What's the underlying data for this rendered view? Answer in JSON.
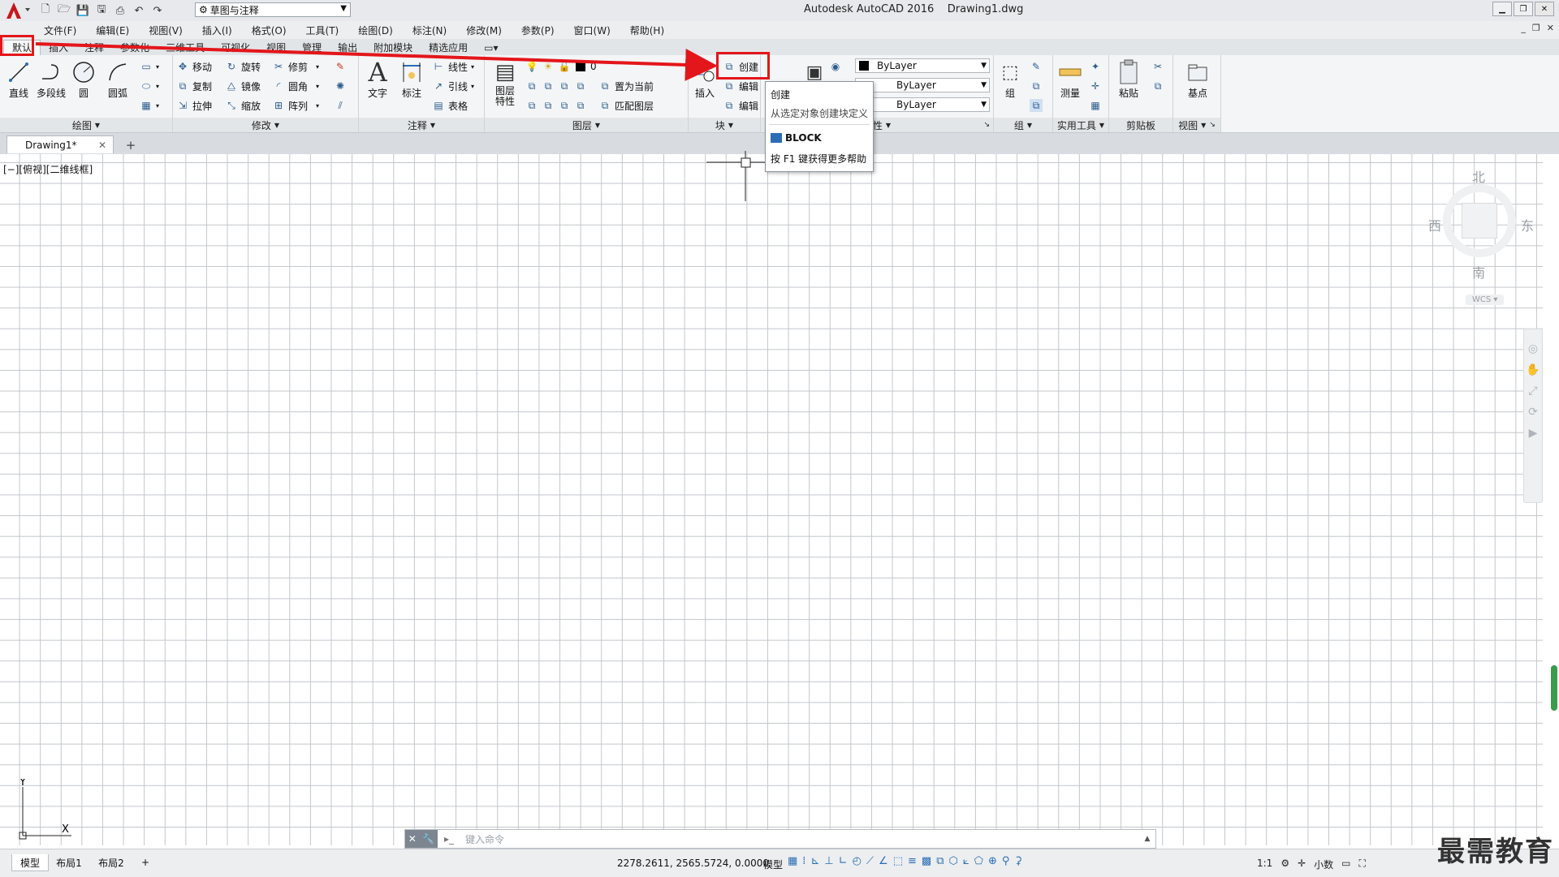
{
  "title": {
    "app": "Autodesk AutoCAD 2016",
    "file": "Drawing1.dwg",
    "workspace": "草图与注释"
  },
  "menu": [
    "文件(F)",
    "编辑(E)",
    "视图(V)",
    "插入(I)",
    "格式(O)",
    "工具(T)",
    "绘图(D)",
    "标注(N)",
    "修改(M)",
    "参数(P)",
    "窗口(W)",
    "帮助(H)"
  ],
  "ribbon_tabs": [
    "默认",
    "插入",
    "注释",
    "参数化",
    "三维工具",
    "可视化",
    "视图",
    "管理",
    "输出",
    "附加模块",
    "精选应用"
  ],
  "panels": {
    "draw": {
      "title": "绘图",
      "line": "直线",
      "polyline": "多段线",
      "circle": "圆",
      "arc": "圆弧"
    },
    "modify": {
      "title": "修改",
      "move": "移动",
      "rotate": "旋转",
      "trim": "修剪",
      "copy": "复制",
      "mirror": "镜像",
      "fillet": "圆角",
      "stretch": "拉伸",
      "scale": "缩放",
      "array": "阵列"
    },
    "annotation": {
      "title": "注释",
      "text": "文字",
      "dimension": "标注",
      "linear": "线性",
      "leader": "引线",
      "table": "表格"
    },
    "layers": {
      "title": "图层",
      "props": "图层\n特性",
      "props_l1": "图层",
      "props_l2": "特性",
      "layer_name": "0",
      "set_current": "置为当前",
      "match": "匹配图层"
    },
    "block": {
      "title": "块",
      "insert": "插入",
      "create": "创建",
      "edit": "编辑",
      "edit_attr": "编辑"
    },
    "properties": {
      "title": "特性",
      "color": "ByLayer",
      "linetype": "ByLayer",
      "lineweight": "ByLayer"
    },
    "groups": {
      "title": "组",
      "group": "组"
    },
    "utilities": {
      "title": "实用工具",
      "measure": "测量"
    },
    "clipboard": {
      "title": "剪贴板",
      "paste": "粘贴"
    },
    "view": {
      "title": "视图",
      "base": "基点"
    }
  },
  "tooltip": {
    "title": "创建",
    "desc": "从选定对象创建块定义",
    "command": "BLOCK",
    "help": "按 F1 键获得更多帮助"
  },
  "doc_tab": "Drawing1*",
  "viewport_label": "[−][俯视][二维线框]",
  "viewcube": {
    "north": "北",
    "south": "南",
    "west": "西",
    "east": "东",
    "wcs": "WCS"
  },
  "ucs": {
    "x": "X",
    "y": "Y"
  },
  "command_placeholder": "键入命令",
  "layout_tabs": [
    "模型",
    "布局1",
    "布局2"
  ],
  "status": {
    "coords": "2278.2611, 2565.5724, 0.0000",
    "model": "模型",
    "scale": "1:1",
    "units": "小数"
  },
  "watermark": "最需教育",
  "colors": {
    "highlight": "#e3161b",
    "accent": "#2c6db5"
  }
}
